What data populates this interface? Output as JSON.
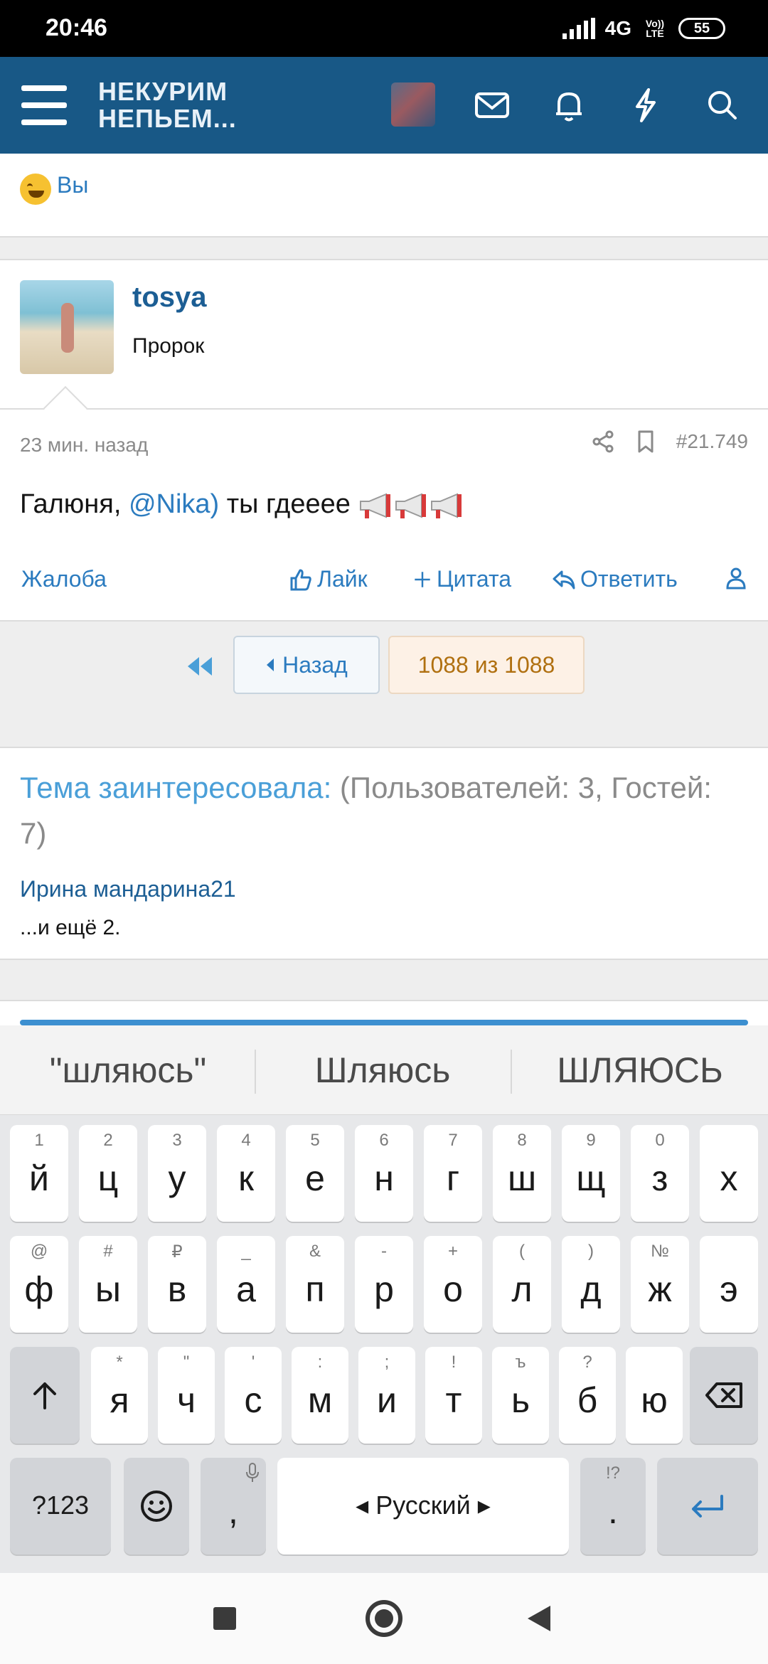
{
  "status_bar": {
    "time": "20:46",
    "network": "4G",
    "volte": "Vo)) LTE",
    "battery": "55"
  },
  "header": {
    "logo_line1": "НЕКУРИМ",
    "logo_line2": "НЕПЬЕМ..."
  },
  "reactions": {
    "label": "Вы"
  },
  "post": {
    "username": "tosya",
    "user_title": "Пророк",
    "time": "23 мин. назад",
    "number": "#21.749",
    "text_before": "Галюня, ",
    "mention": "@Nika)",
    "text_after": " ты гдееее",
    "actions": {
      "report": "Жалоба",
      "like": "Лайк",
      "quote": "Цитата",
      "reply": "Ответить"
    }
  },
  "pagination": {
    "back": "Назад",
    "info": "1088 из 1088"
  },
  "online": {
    "title": "Тема заинтересовала:",
    "counts": "(Пользователей: 3, Гостей: 7)",
    "user": "Ирина мандарина21",
    "more": "...и ещё 2."
  },
  "keyboard": {
    "suggestions": [
      "\"шляюсь\"",
      "Шляюсь",
      "ШЛЯЮСЬ"
    ],
    "row1": [
      {
        "ch": "й",
        "hint": "1"
      },
      {
        "ch": "ц",
        "hint": "2"
      },
      {
        "ch": "у",
        "hint": "3"
      },
      {
        "ch": "к",
        "hint": "4"
      },
      {
        "ch": "е",
        "hint": "5"
      },
      {
        "ch": "н",
        "hint": "6"
      },
      {
        "ch": "г",
        "hint": "7"
      },
      {
        "ch": "ш",
        "hint": "8"
      },
      {
        "ch": "щ",
        "hint": "9"
      },
      {
        "ch": "з",
        "hint": "0"
      },
      {
        "ch": "х",
        "hint": ""
      }
    ],
    "row2": [
      {
        "ch": "ф",
        "hint": "@"
      },
      {
        "ch": "ы",
        "hint": "#"
      },
      {
        "ch": "в",
        "hint": "₽"
      },
      {
        "ch": "а",
        "hint": "_"
      },
      {
        "ch": "п",
        "hint": "&"
      },
      {
        "ch": "р",
        "hint": "-"
      },
      {
        "ch": "о",
        "hint": "+"
      },
      {
        "ch": "л",
        "hint": "("
      },
      {
        "ch": "д",
        "hint": ")"
      },
      {
        "ch": "ж",
        "hint": "№"
      },
      {
        "ch": "э",
        "hint": ""
      }
    ],
    "row3": [
      {
        "ch": "я",
        "hint": "*"
      },
      {
        "ch": "ч",
        "hint": "\""
      },
      {
        "ch": "с",
        "hint": "'"
      },
      {
        "ch": "м",
        "hint": ":"
      },
      {
        "ch": "и",
        "hint": ";"
      },
      {
        "ch": "т",
        "hint": "!"
      },
      {
        "ch": "ь",
        "hint": "ъ"
      },
      {
        "ch": "б",
        "hint": "?"
      },
      {
        "ch": "ю",
        "hint": ""
      }
    ],
    "symbols_label": "?123",
    "comma": ",",
    "space_label": "Русский",
    "period": ".",
    "period_hint": "!?"
  }
}
